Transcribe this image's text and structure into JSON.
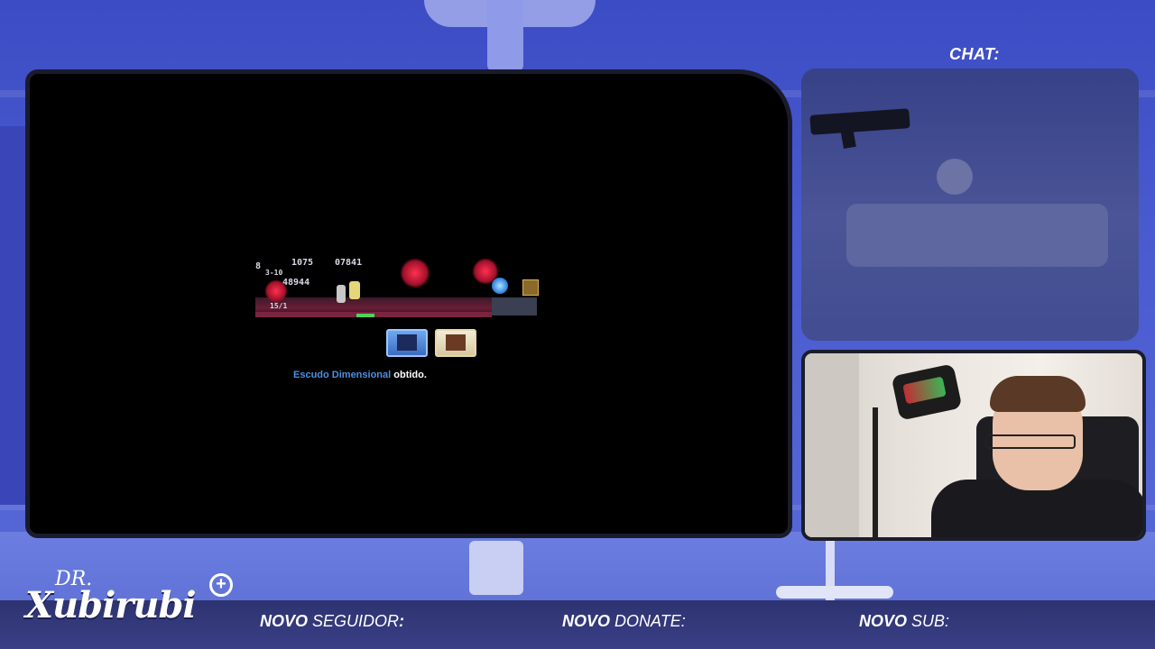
{
  "overlay": {
    "chat_title": "CHAT:",
    "logo": {
      "dr": "DR.",
      "name": "Xubirubi",
      "plus": "+"
    },
    "alerts": [
      {
        "strong": "NOVO",
        "word": "SEGUIDOR",
        "colon": ":"
      },
      {
        "strong": "NOVO",
        "word": "DONATE",
        "colon": ":"
      },
      {
        "strong": "NOVO",
        "word": "SUB",
        "colon": ":"
      }
    ]
  },
  "game": {
    "hud_numbers": {
      "left_count": "8",
      "range": "3-10",
      "gold": "1075",
      "stat_a": "48944",
      "stat_b": "07841",
      "counter": "15/1"
    },
    "message": {
      "item_name": "Escudo Dimensional",
      "suffix": " obtido."
    },
    "icons": [
      "dimensional-shield-icon",
      "treasure-chest-icon"
    ]
  },
  "colors": {
    "item_highlight": "#4e8fe0",
    "bottom_bar": "#2d3370",
    "background": "#4656c8"
  }
}
